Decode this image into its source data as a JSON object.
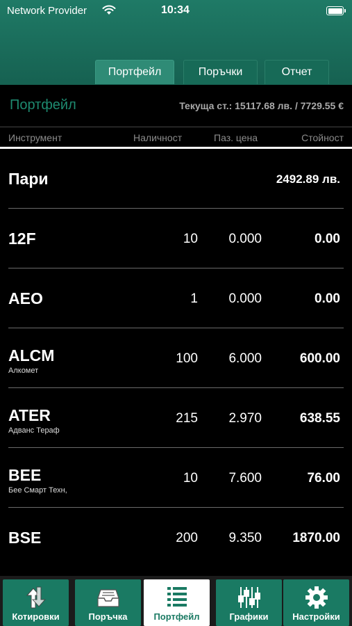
{
  "status_bar": {
    "carrier": "Network Provider",
    "time": "10:34"
  },
  "tabs": [
    {
      "label": "Портфейл",
      "active": true
    },
    {
      "label": "Поръчки",
      "active": false
    },
    {
      "label": "Отчет",
      "active": false
    }
  ],
  "summary": {
    "title": "Портфейл",
    "current_value": "Текуща ст.: 15117.68 лв. / 7729.55 €"
  },
  "columns": {
    "instrument": "Инструмент",
    "quantity": "Наличност",
    "market_price": "Паз. цена",
    "value": "Стойност"
  },
  "cash": {
    "label": "Пари",
    "amount": "2492.89 лв."
  },
  "holdings": [
    {
      "symbol": "12F",
      "name": "",
      "quantity": "10",
      "price": "0.000",
      "value": "0.00"
    },
    {
      "symbol": "AEO",
      "name": "",
      "quantity": "1",
      "price": "0.000",
      "value": "0.00"
    },
    {
      "symbol": "ALCM",
      "name": "Алкомет",
      "quantity": "100",
      "price": "6.000",
      "value": "600.00"
    },
    {
      "symbol": "ATER",
      "name": "Адванс Тераф",
      "quantity": "215",
      "price": "2.970",
      "value": "638.55"
    },
    {
      "symbol": "BEE",
      "name": "Бее Смарт Техн,",
      "quantity": "10",
      "price": "7.600",
      "value": "76.00"
    },
    {
      "symbol": "BSE",
      "name": "",
      "quantity": "200",
      "price": "9.350",
      "value": "1870.00"
    }
  ],
  "bottom_nav": [
    {
      "label": "Котировки",
      "icon": "quotes-icon",
      "active": false
    },
    {
      "label": "Поръчка",
      "icon": "order-tray-icon",
      "active": false
    },
    {
      "label": "Портфейл",
      "icon": "list-icon",
      "active": true
    },
    {
      "label": "Графики",
      "icon": "sliders-chart-icon",
      "active": false
    },
    {
      "label": "Настройки",
      "icon": "gear-icon",
      "active": false
    }
  ]
}
